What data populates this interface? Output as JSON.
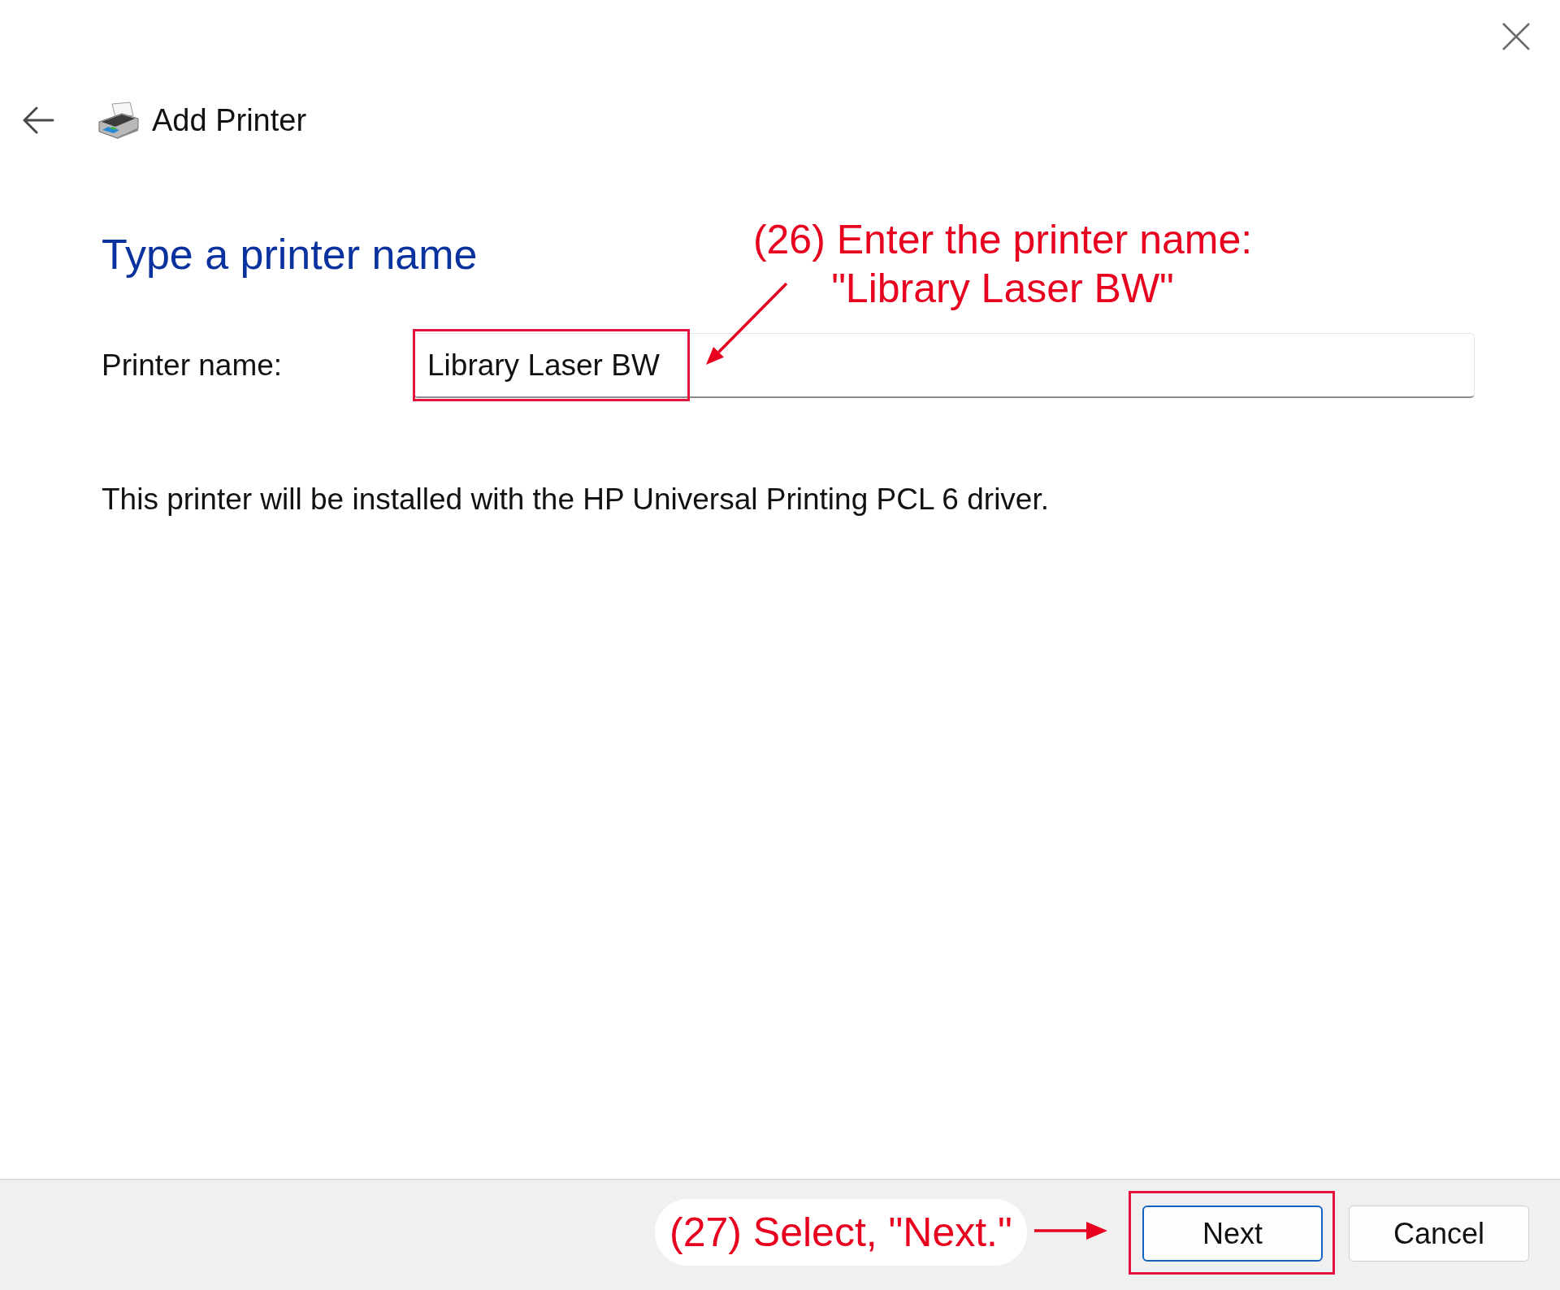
{
  "window": {
    "title": "Add Printer"
  },
  "page": {
    "heading": "Type a printer name",
    "printer_name": {
      "label": "Printer name:",
      "value": "Library Laser BW",
      "highlighted": true
    },
    "note": "This printer will be installed with the HP Universal Printing PCL 6 driver."
  },
  "buttons": [
    {
      "label": "Next",
      "kind": "default",
      "highlighted": true
    },
    {
      "label": "Cancel",
      "kind": "normal",
      "highlighted": false
    }
  ],
  "annotations": [
    {
      "kind": "field",
      "text": "(26) Enter the printer name:\n\"Library Laser BW\""
    },
    {
      "kind": "button",
      "text": "(27) Select, \"Next.\""
    }
  ]
}
